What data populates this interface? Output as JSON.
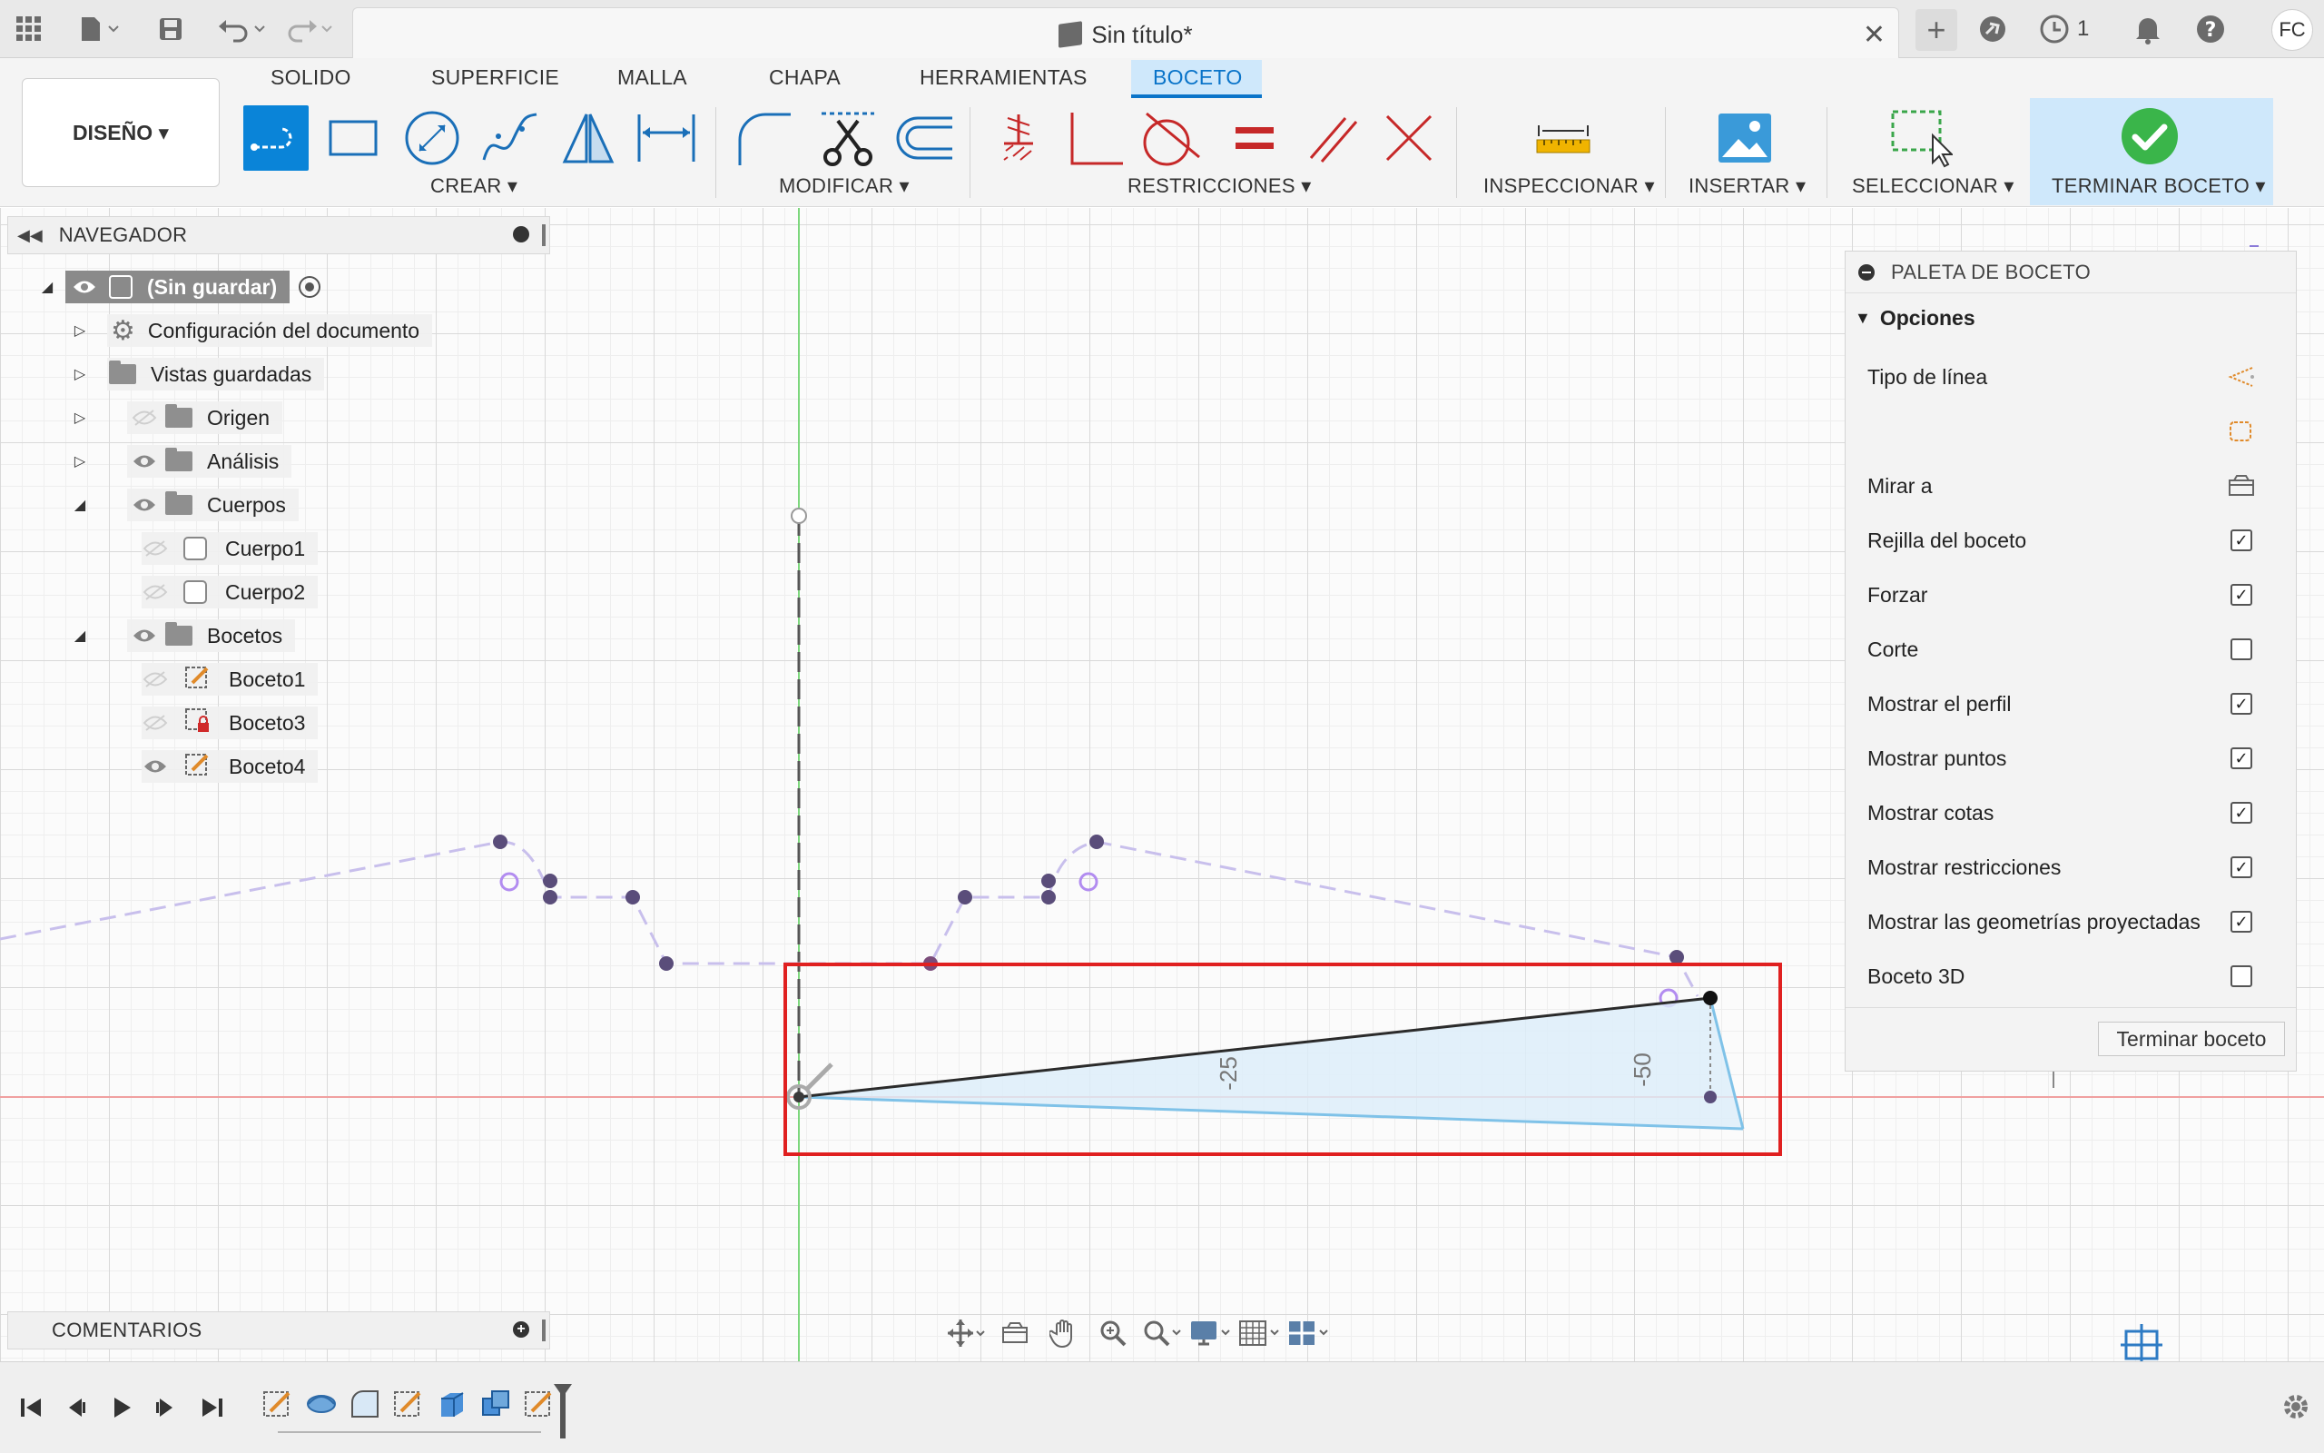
{
  "titlebar": {
    "document_title": "Sin título*",
    "notifications_count": "1",
    "user_initials": "FC"
  },
  "toolbar": {
    "tabs": [
      "SOLIDO",
      "SUPERFICIE",
      "MALLA",
      "CHAPA",
      "HERRAMIENTAS",
      "BOCETO"
    ],
    "active_tab": "BOCETO",
    "workspace_button": "DISEÑO ▾",
    "groups": {
      "crear": "CREAR ▾",
      "modificar": "MODIFICAR ▾",
      "restricciones": "RESTRICCIONES ▾",
      "inspeccionar": "INSPECCIONAR ▾",
      "insertar": "INSERTAR ▾",
      "seleccionar": "SELECCIONAR ▾",
      "terminar": "TERMINAR BOCETO ▾"
    }
  },
  "navigator": {
    "title": "NAVEGADOR",
    "root": "(Sin guardar)",
    "items": [
      {
        "label": "Configuración del documento",
        "icon": "gear-icon"
      },
      {
        "label": "Vistas guardadas",
        "icon": "folder-icon"
      },
      {
        "label": "Origen",
        "icon": "folder-icon"
      },
      {
        "label": "Análisis",
        "icon": "folder-icon"
      },
      {
        "label": "Cuerpos",
        "icon": "folder-icon"
      },
      {
        "label": "Cuerpo1",
        "icon": "body-icon"
      },
      {
        "label": "Cuerpo2",
        "icon": "body-icon"
      },
      {
        "label": "Bocetos",
        "icon": "folder-icon"
      },
      {
        "label": "Boceto1",
        "icon": "sketch-icon"
      },
      {
        "label": "Boceto3",
        "icon": "sketch-locked-icon"
      },
      {
        "label": "Boceto4",
        "icon": "sketch-icon"
      }
    ]
  },
  "comments": {
    "title": "COMENTARIOS"
  },
  "palette": {
    "title": "PALETA DE BOCETO",
    "section": "Opciones",
    "rows": [
      {
        "label": "Tipo de línea",
        "control": "icon"
      },
      {
        "label": "",
        "control": "icon"
      },
      {
        "label": "Mirar a",
        "control": "icon"
      },
      {
        "label": "Rejilla del boceto",
        "checked": true
      },
      {
        "label": "Forzar",
        "checked": true
      },
      {
        "label": "Corte",
        "checked": false
      },
      {
        "label": "Mostrar el perfil",
        "checked": true
      },
      {
        "label": "Mostrar puntos",
        "checked": true
      },
      {
        "label": "Mostrar cotas",
        "checked": true
      },
      {
        "label": "Mostrar restricciones",
        "checked": true
      },
      {
        "label": "Mostrar las geometrías proyectadas",
        "checked": true
      },
      {
        "label": "Boceto 3D",
        "checked": false
      }
    ],
    "finish_button": "Terminar boceto"
  },
  "canvas": {
    "dimension_labels": [
      "-25",
      "-50"
    ],
    "highlight_color": "#e02020",
    "profile_color": "#7fc2e8",
    "projected_color": "#b8a8e8"
  }
}
